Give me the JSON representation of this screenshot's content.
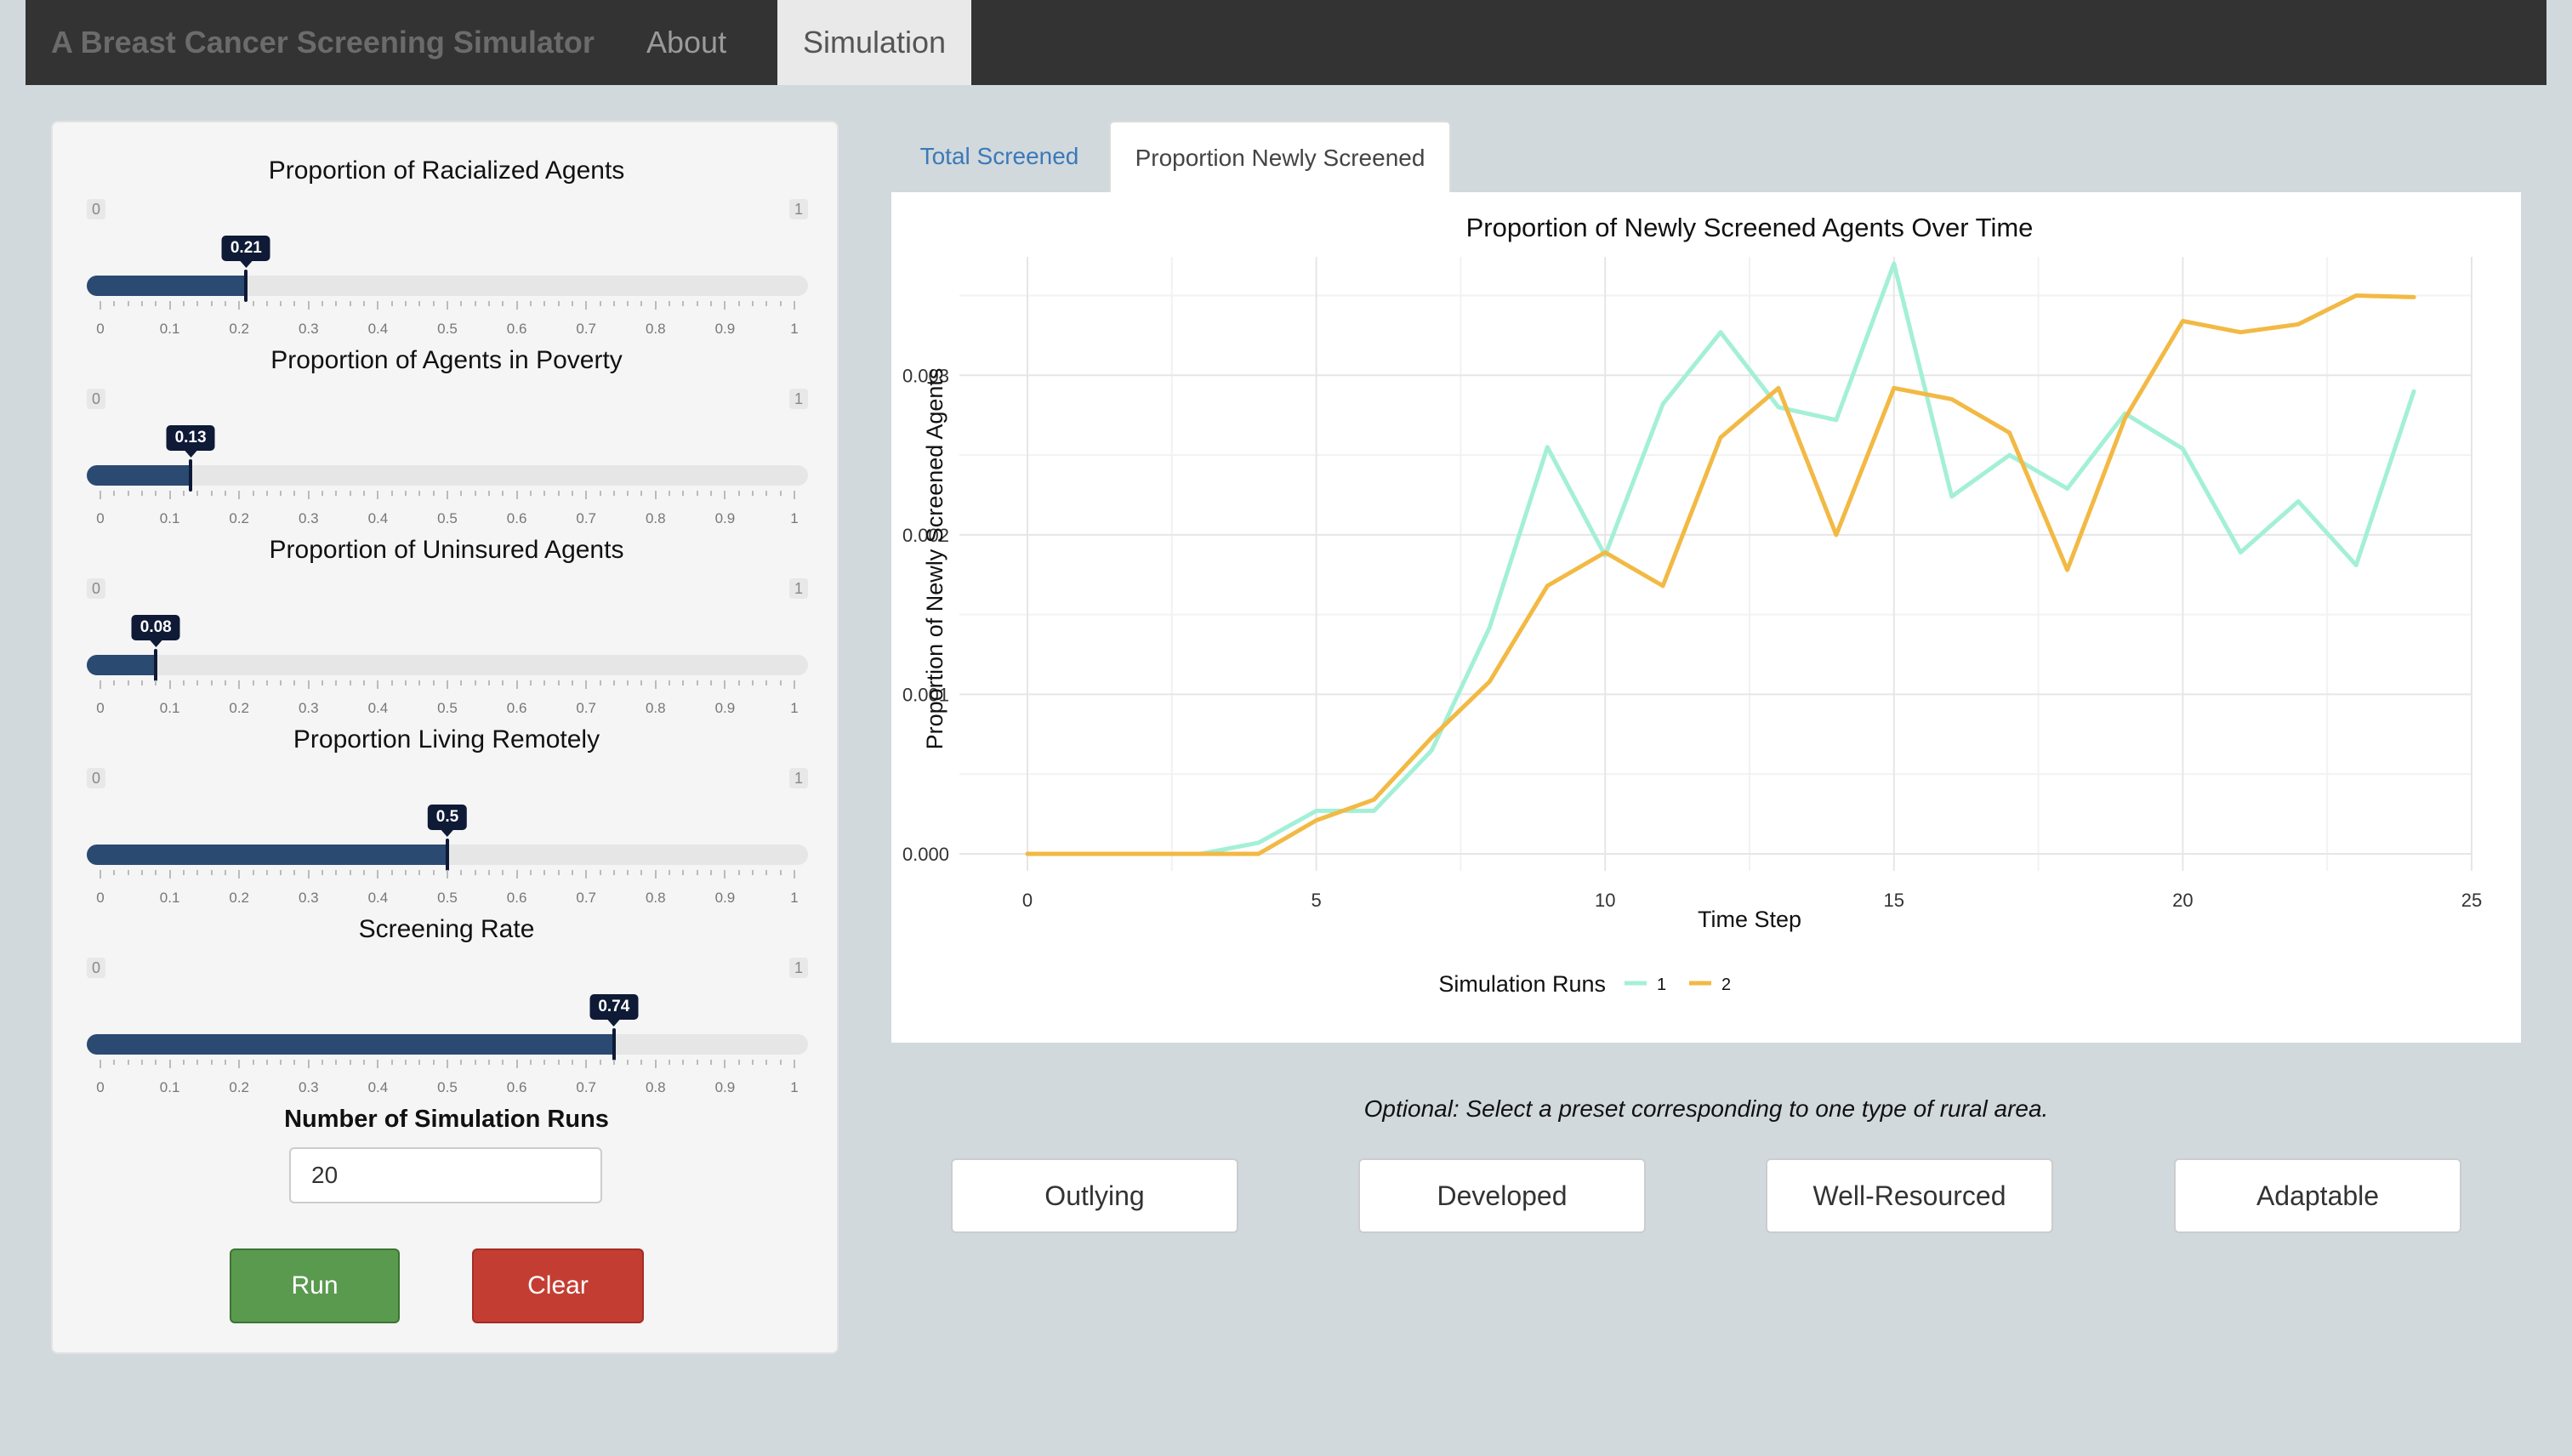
{
  "nav": {
    "brand": "A Breast Cancer Screening Simulator",
    "about": "About",
    "simulation": "Simulation"
  },
  "sliders": [
    {
      "label": "Proportion of Racialized Agents",
      "value": 0.21,
      "value_label": "0.21",
      "min": "0",
      "max": "1"
    },
    {
      "label": "Proportion of Agents in Poverty",
      "value": 0.13,
      "value_label": "0.13",
      "min": "0",
      "max": "1"
    },
    {
      "label": "Proportion of Uninsured Agents",
      "value": 0.08,
      "value_label": "0.08",
      "min": "0",
      "max": "1"
    },
    {
      "label": "Proportion Living Remotely",
      "value": 0.5,
      "value_label": "0.5",
      "min": "0",
      "max": "1"
    },
    {
      "label": "Screening Rate",
      "value": 0.74,
      "value_label": "0.74",
      "min": "0",
      "max": "1"
    }
  ],
  "slider_ticks": [
    "0",
    "0.1",
    "0.2",
    "0.3",
    "0.4",
    "0.5",
    "0.6",
    "0.7",
    "0.8",
    "0.9",
    "1"
  ],
  "runs": {
    "label": "Number of Simulation Runs",
    "value": "20"
  },
  "buttons": {
    "run": "Run",
    "clear": "Clear"
  },
  "tabs": {
    "total": "Total Screened",
    "proportion": "Proportion Newly Screened"
  },
  "chart_data": {
    "type": "line",
    "title": "Proportion of Newly Screened Agents Over Time",
    "xlabel": "Time Step",
    "ylabel": "Proportion of Newly Screened Agents",
    "xlim": [
      0,
      25
    ],
    "ylim": [
      0,
      0.0037
    ],
    "xticks": [
      0,
      5,
      10,
      15,
      20,
      25
    ],
    "xtick_labels": [
      "0",
      "5",
      "10",
      "15",
      "20",
      "25"
    ],
    "yticks": [
      0,
      0.001,
      0.002,
      0.003
    ],
    "ytick_labels": [
      "0.000",
      "0.001",
      "0.002",
      "0.003"
    ],
    "grid": true,
    "legend_title": "Simulation Runs",
    "legend_position": "bottom",
    "x": [
      0,
      1,
      2,
      3,
      4,
      5,
      6,
      7,
      8,
      9,
      10,
      11,
      12,
      13,
      14,
      15,
      16,
      17,
      18,
      19,
      20,
      21,
      22,
      23,
      24
    ],
    "series": [
      {
        "name": "1",
        "color": "#a3f0d6",
        "values": [
          0,
          0,
          0,
          0,
          7e-05,
          0.00027,
          0.00027,
          0.00065,
          0.00142,
          0.00255,
          0.00187,
          0.00282,
          0.00327,
          0.0028,
          0.00272,
          0.0037,
          0.00224,
          0.0025,
          0.00229,
          0.00276,
          0.00254,
          0.00189,
          0.00221,
          0.00181,
          0.0029
        ]
      },
      {
        "name": "2",
        "color": "#f2b944",
        "values": [
          0,
          0,
          0,
          0,
          0,
          0.00021,
          0.00034,
          0.00073,
          0.00108,
          0.00168,
          0.00189,
          0.00168,
          0.00261,
          0.00292,
          0.002,
          0.00292,
          0.00285,
          0.00264,
          0.00178,
          0.00273,
          0.00334,
          0.00327,
          0.00332,
          0.0035,
          0.00349
        ]
      }
    ]
  },
  "presets": {
    "note": "Optional: Select a preset corresponding to one type of rural area.",
    "buttons": [
      "Outlying",
      "Developed",
      "Well-Resourced",
      "Adaptable"
    ]
  }
}
